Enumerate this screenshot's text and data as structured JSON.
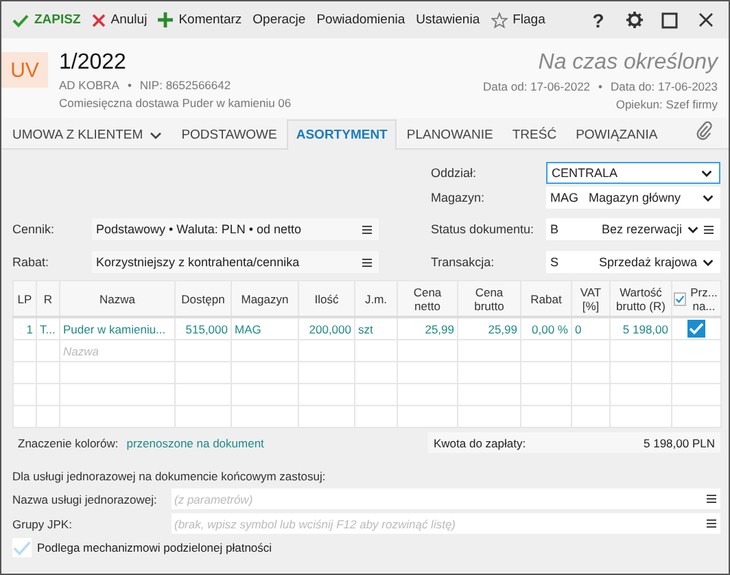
{
  "toolbar": {
    "actions": [
      {
        "kind": "save",
        "label": "ZAPISZ"
      },
      {
        "kind": "cancel",
        "label": "Anuluj"
      },
      {
        "kind": "add",
        "label": "Komentarz"
      },
      {
        "kind": "plain",
        "label": "Operacje"
      },
      {
        "kind": "plain",
        "label": "Powiadomienia"
      },
      {
        "kind": "plain",
        "label": "Ustawienia"
      },
      {
        "kind": "flag",
        "label": "Flaga"
      }
    ],
    "help": "?"
  },
  "header": {
    "badge": "UV",
    "number": "1/2022",
    "company": "AD KOBRA",
    "nip": "NIP: 8652566642",
    "separator": "•",
    "description": "Comiesięczna dostawa Puder w kamieniu 06",
    "status": "Na czas określony",
    "date_from": "Data od: 17-06-2022",
    "date_to": "Data do: 17-06-2023",
    "keeper": "Opiekun: Szef firmy"
  },
  "tabs": [
    {
      "label": "UMOWA Z KLIENTEM",
      "selected": false,
      "dropdown": true
    },
    {
      "label": "PODSTAWOWE",
      "selected": false,
      "dropdown": false
    },
    {
      "label": "ASORTYMENT",
      "selected": true,
      "dropdown": false
    },
    {
      "label": "PLANOWANIE",
      "selected": false,
      "dropdown": false
    },
    {
      "label": "TREŚĆ",
      "selected": false,
      "dropdown": false
    },
    {
      "label": "POWIĄZANIA",
      "selected": false,
      "dropdown": false
    }
  ],
  "form": {
    "oddzial": {
      "label": "Oddział:",
      "value": "CENTRALA"
    },
    "magazyn": {
      "label": "Magazyn:",
      "code": "MAG",
      "value": "Magazyn główny"
    },
    "cennik": {
      "label": "Cennik:",
      "value": "Podstawowy • Waluta: PLN • od netto"
    },
    "rabat": {
      "label": "Rabat:",
      "value": "Korzystniejszy z kontrahenta/cennika"
    },
    "status": {
      "label": "Status dokumentu:",
      "code": "B",
      "value": "Bez rezerwacji"
    },
    "transakcja": {
      "label": "Transakcja:",
      "code": "S",
      "value": "Sprzedaż krajowa"
    }
  },
  "table": {
    "columns": [
      "LP",
      "R",
      "Nazwa",
      "Dostępn",
      "Magazyn",
      "Ilość",
      "J.m.",
      "Cena netto",
      "Cena brutto",
      "Rabat",
      "VAT [%]",
      "Wartość brutto (R)",
      "Prz... na..."
    ],
    "header_checked": true,
    "rows": [
      {
        "cells": [
          "1",
          "T...",
          "Puder w kamieniu...",
          "515,000",
          "MAG",
          "200,000",
          "szt",
          "25,99",
          "25,99",
          "0,00 %",
          "0",
          "5 198,00"
        ],
        "checked": true
      }
    ],
    "new_row_placeholder": "Nazwa"
  },
  "legend": {
    "label": "Znaczenie kolorów:",
    "link": "przenoszone na dokument"
  },
  "total": {
    "label": "Kwota do zapłaty:",
    "value": "5 198,00 PLN"
  },
  "service": {
    "heading": "Dla usługi jednorazowej na dokumencie końcowym zastosuj:",
    "fields": [
      {
        "label": "Nazwa usługi jednorazowej:",
        "placeholder": "(z parametrów)"
      },
      {
        "label": "Grupy JPK:",
        "placeholder": "(brak, wpisz symbol lub wciśnij F12 aby rozwinąć listę)"
      }
    ],
    "split_payment": {
      "label": "Podlega mechanizmowi podzielonej płatności",
      "checked": true
    }
  }
}
